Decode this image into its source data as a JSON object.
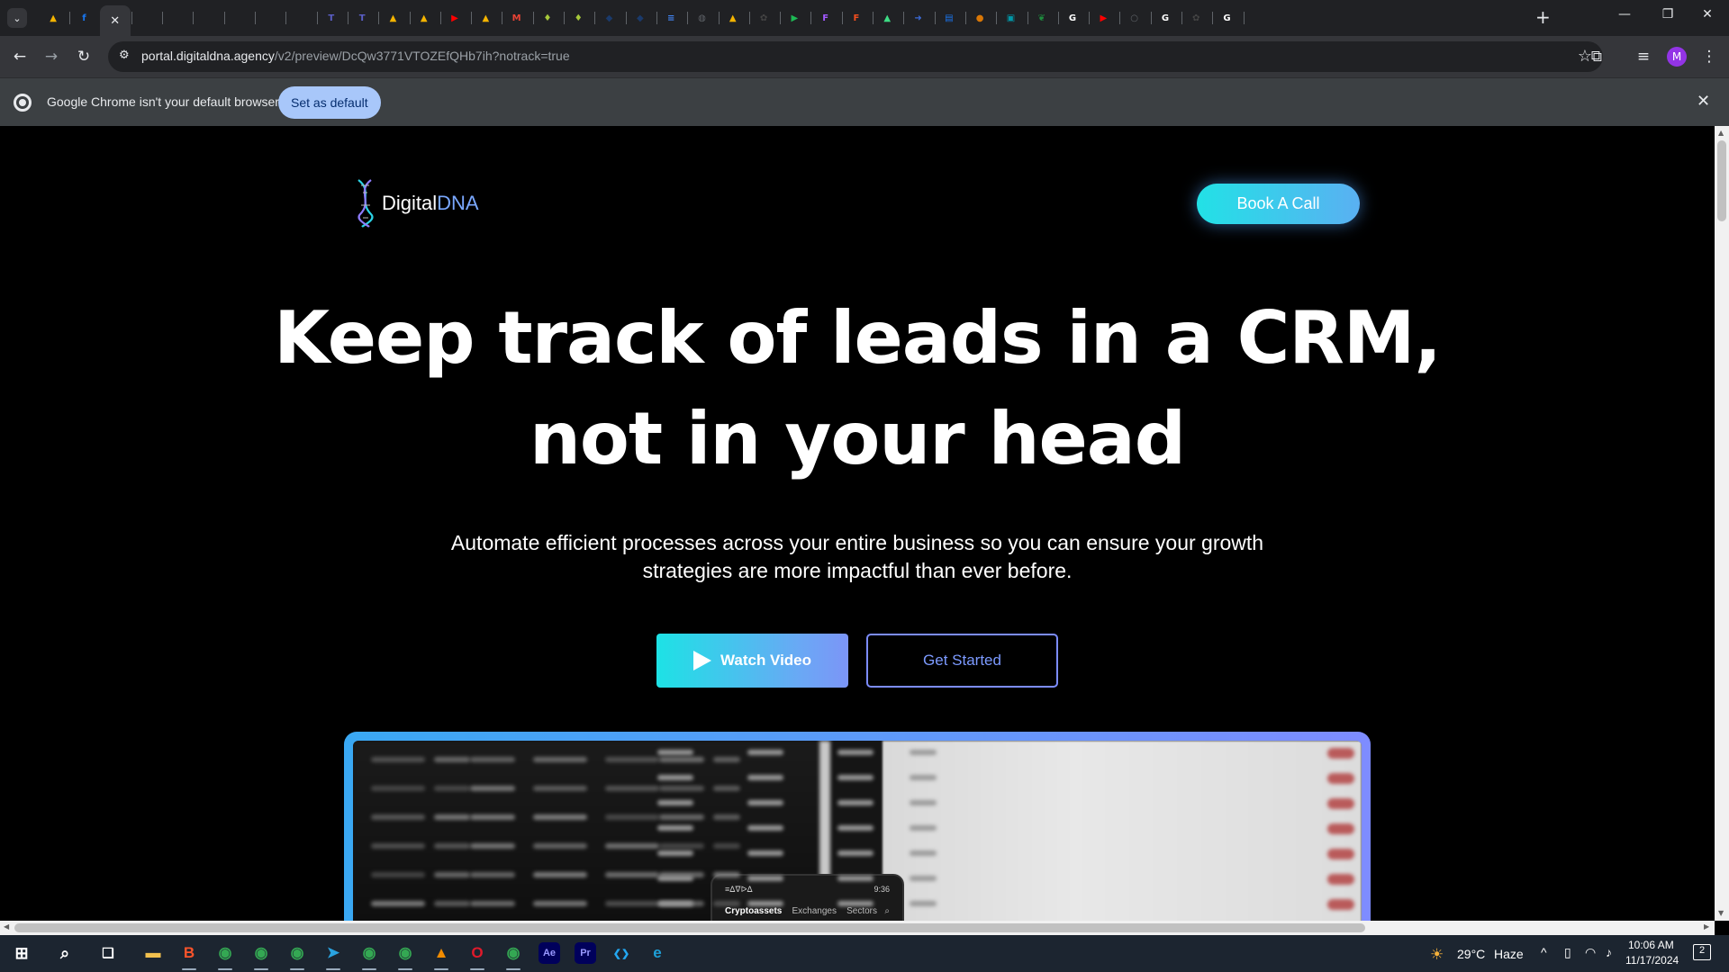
{
  "browser": {
    "tabs": [
      {
        "icon": "google-drive-icon",
        "color": "#f4b400",
        "glyph": "▲"
      },
      {
        "icon": "facebook-icon",
        "color": "#1877f2",
        "glyph": "f"
      },
      {
        "icon": "active-tab-close-icon",
        "glyph": "✕"
      },
      {
        "icon": "blank-tab-icon",
        "glyph": ""
      },
      {
        "icon": "blank-tab-icon",
        "glyph": ""
      },
      {
        "icon": "blank-tab-icon",
        "glyph": ""
      },
      {
        "icon": "blank-tab-icon",
        "glyph": ""
      },
      {
        "icon": "blank-tab-icon",
        "glyph": ""
      },
      {
        "icon": "blank-tab-icon",
        "glyph": ""
      },
      {
        "icon": "teams-icon",
        "color": "#5b5fc7",
        "glyph": "T"
      },
      {
        "icon": "teams-icon",
        "color": "#5b5fc7",
        "glyph": "T"
      },
      {
        "icon": "google-drive-icon",
        "color": "#f4b400",
        "glyph": "▲"
      },
      {
        "icon": "google-drive-icon",
        "color": "#f4b400",
        "glyph": "▲"
      },
      {
        "icon": "youtube-icon",
        "color": "#ff0000",
        "glyph": "▶"
      },
      {
        "icon": "google-drive-icon",
        "color": "#f4b400",
        "glyph": "▲"
      },
      {
        "icon": "gmail-icon",
        "color": "#ea4335",
        "glyph": "M"
      },
      {
        "icon": "lightbulb-icon",
        "color": "#a6c83a",
        "glyph": "♦"
      },
      {
        "icon": "lightbulb-icon",
        "color": "#a6c83a",
        "glyph": "♦"
      },
      {
        "icon": "shield-icon",
        "color": "#1a3a6b",
        "glyph": "◆"
      },
      {
        "icon": "shield-icon",
        "color": "#1a3a6b",
        "glyph": "◆"
      },
      {
        "icon": "google-docs-icon",
        "color": "#4285f4",
        "glyph": "≡"
      },
      {
        "icon": "globe-icon",
        "color": "#5f6368",
        "glyph": "◍"
      },
      {
        "icon": "google-drive-icon",
        "color": "#f4b400",
        "glyph": "▲"
      },
      {
        "icon": "openai-icon",
        "color": "#444",
        "glyph": "✿"
      },
      {
        "icon": "play-icon",
        "color": "#1db954",
        "glyph": "▶"
      },
      {
        "icon": "figma-icon",
        "color": "#a259ff",
        "glyph": "F"
      },
      {
        "icon": "figma-icon",
        "color": "#f24e1e",
        "glyph": "F"
      },
      {
        "icon": "android-icon",
        "color": "#3ddc84",
        "glyph": "▲"
      },
      {
        "icon": "arrow-icon",
        "color": "#3b6bd8",
        "glyph": "➜"
      },
      {
        "icon": "dictionary-icon",
        "color": "#1a73e8",
        "glyph": "▤"
      },
      {
        "icon": "avatar-icon",
        "color": "#d97706",
        "glyph": "●"
      },
      {
        "icon": "image-icon",
        "color": "#0097a7",
        "glyph": "▣"
      },
      {
        "icon": "leaf-icon",
        "color": "#1e8e3e",
        "glyph": "❦"
      },
      {
        "icon": "google-icon",
        "color": "#ffffff",
        "glyph": "G"
      },
      {
        "icon": "youtube-icon",
        "color": "#ff0000",
        "glyph": "▶"
      },
      {
        "icon": "circle-icon",
        "color": "#5f6368",
        "glyph": "○"
      },
      {
        "icon": "google-icon",
        "color": "#ffffff",
        "glyph": "G"
      },
      {
        "icon": "openai-icon",
        "color": "#444",
        "glyph": "✿"
      },
      {
        "icon": "google-icon",
        "color": "#ffffff",
        "glyph": "G"
      }
    ],
    "address": {
      "host": "portal.digitaldna.agency",
      "path": "/v2/preview/DcQw3771VTOZEfQHb7ih?notrack=true"
    },
    "infobar": {
      "message": "Google Chrome isn't your default browser",
      "button": "Set as default"
    },
    "profile_initial": "M"
  },
  "page": {
    "logo": {
      "part1": "Digital",
      "part2": "DNA"
    },
    "book_call": "Book A Call",
    "headline": "Keep track of leads in a CRM, not in your head",
    "subheadline": "Automate efficient processes across your entire business so you can ensure your growth strategies are more impactful than ever before.",
    "watch_video": "Watch Video",
    "get_started": "Get Started",
    "preview_phone_tabs": [
      "Cryptoassets",
      "Exchanges",
      "Sectors"
    ],
    "preview_phone_header": "≡ᐃᐁᐅᐃ",
    "preview_phone_time": "9:36"
  },
  "taskbar": {
    "weather": {
      "temp": "29°C",
      "condition": "Haze"
    },
    "time": "10:06 AM",
    "date": "11/17/2024",
    "notifications": "2",
    "apps": [
      {
        "name": "file-explorer-icon",
        "color": "#f2c14e",
        "glyph": "▬"
      },
      {
        "name": "brave-icon",
        "color": "#fb542b",
        "glyph": "B"
      },
      {
        "name": "chrome-icon",
        "color": "#34a853",
        "glyph": "◉"
      },
      {
        "name": "chrome-icon",
        "color": "#34a853",
        "glyph": "◉"
      },
      {
        "name": "chrome-icon",
        "color": "#34a853",
        "glyph": "◉"
      },
      {
        "name": "telegram-icon",
        "color": "#2aa3e0",
        "glyph": "➤"
      },
      {
        "name": "chrome-icon",
        "color": "#34a853",
        "glyph": "◉"
      },
      {
        "name": "chrome-icon",
        "color": "#34a853",
        "glyph": "◉"
      },
      {
        "name": "vlc-icon",
        "color": "#f28c00",
        "glyph": "▲"
      },
      {
        "name": "opera-icon",
        "color": "#e01a2b",
        "glyph": "O"
      },
      {
        "name": "chrome-icon",
        "color": "#34a853",
        "glyph": "◉"
      },
      {
        "name": "after-effects-icon",
        "color": "#2a2a5e",
        "glyph": "Ae"
      },
      {
        "name": "premiere-pro-icon",
        "color": "#2a2a5e",
        "glyph": "Pr"
      },
      {
        "name": "vscode-icon",
        "color": "#23a8f2",
        "glyph": "❮❯"
      },
      {
        "name": "edge-icon",
        "color": "#1ea0d8",
        "glyph": "e"
      }
    ]
  }
}
